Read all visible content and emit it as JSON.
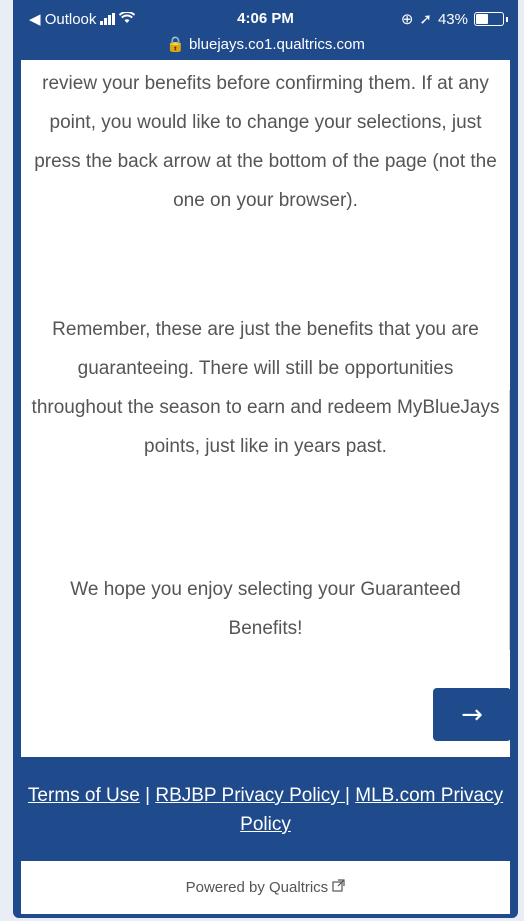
{
  "status_bar": {
    "back_app": "◀ Outlook",
    "time": "4:06 PM",
    "battery": "43%",
    "url": "bluejays.co1.qualtrics.com"
  },
  "content": {
    "paragraph1": "review your benefits before confirming them. If at any point, you would like to change your selections, just press the back arrow at the bottom of the page (not the one on your browser).",
    "paragraph2": "Remember, these are just the benefits that you are guaranteeing. There will still be opportunities throughout the season to earn and redeem MyBlueJays points, just like in years past.",
    "paragraph3": "We hope you enjoy selecting your Guaranteed Benefits!",
    "next_label": "→"
  },
  "footer": {
    "terms": "Terms of Use",
    "sep1": " | ",
    "rbjbp": "RBJBP Privacy Policy ",
    "sep2": "| ",
    "mlb": "MLB.com Privacy Policy"
  },
  "powered_by": "Powered by Qualtrics",
  "colors": {
    "brand": "#1f4a8c",
    "text": "#555555"
  }
}
